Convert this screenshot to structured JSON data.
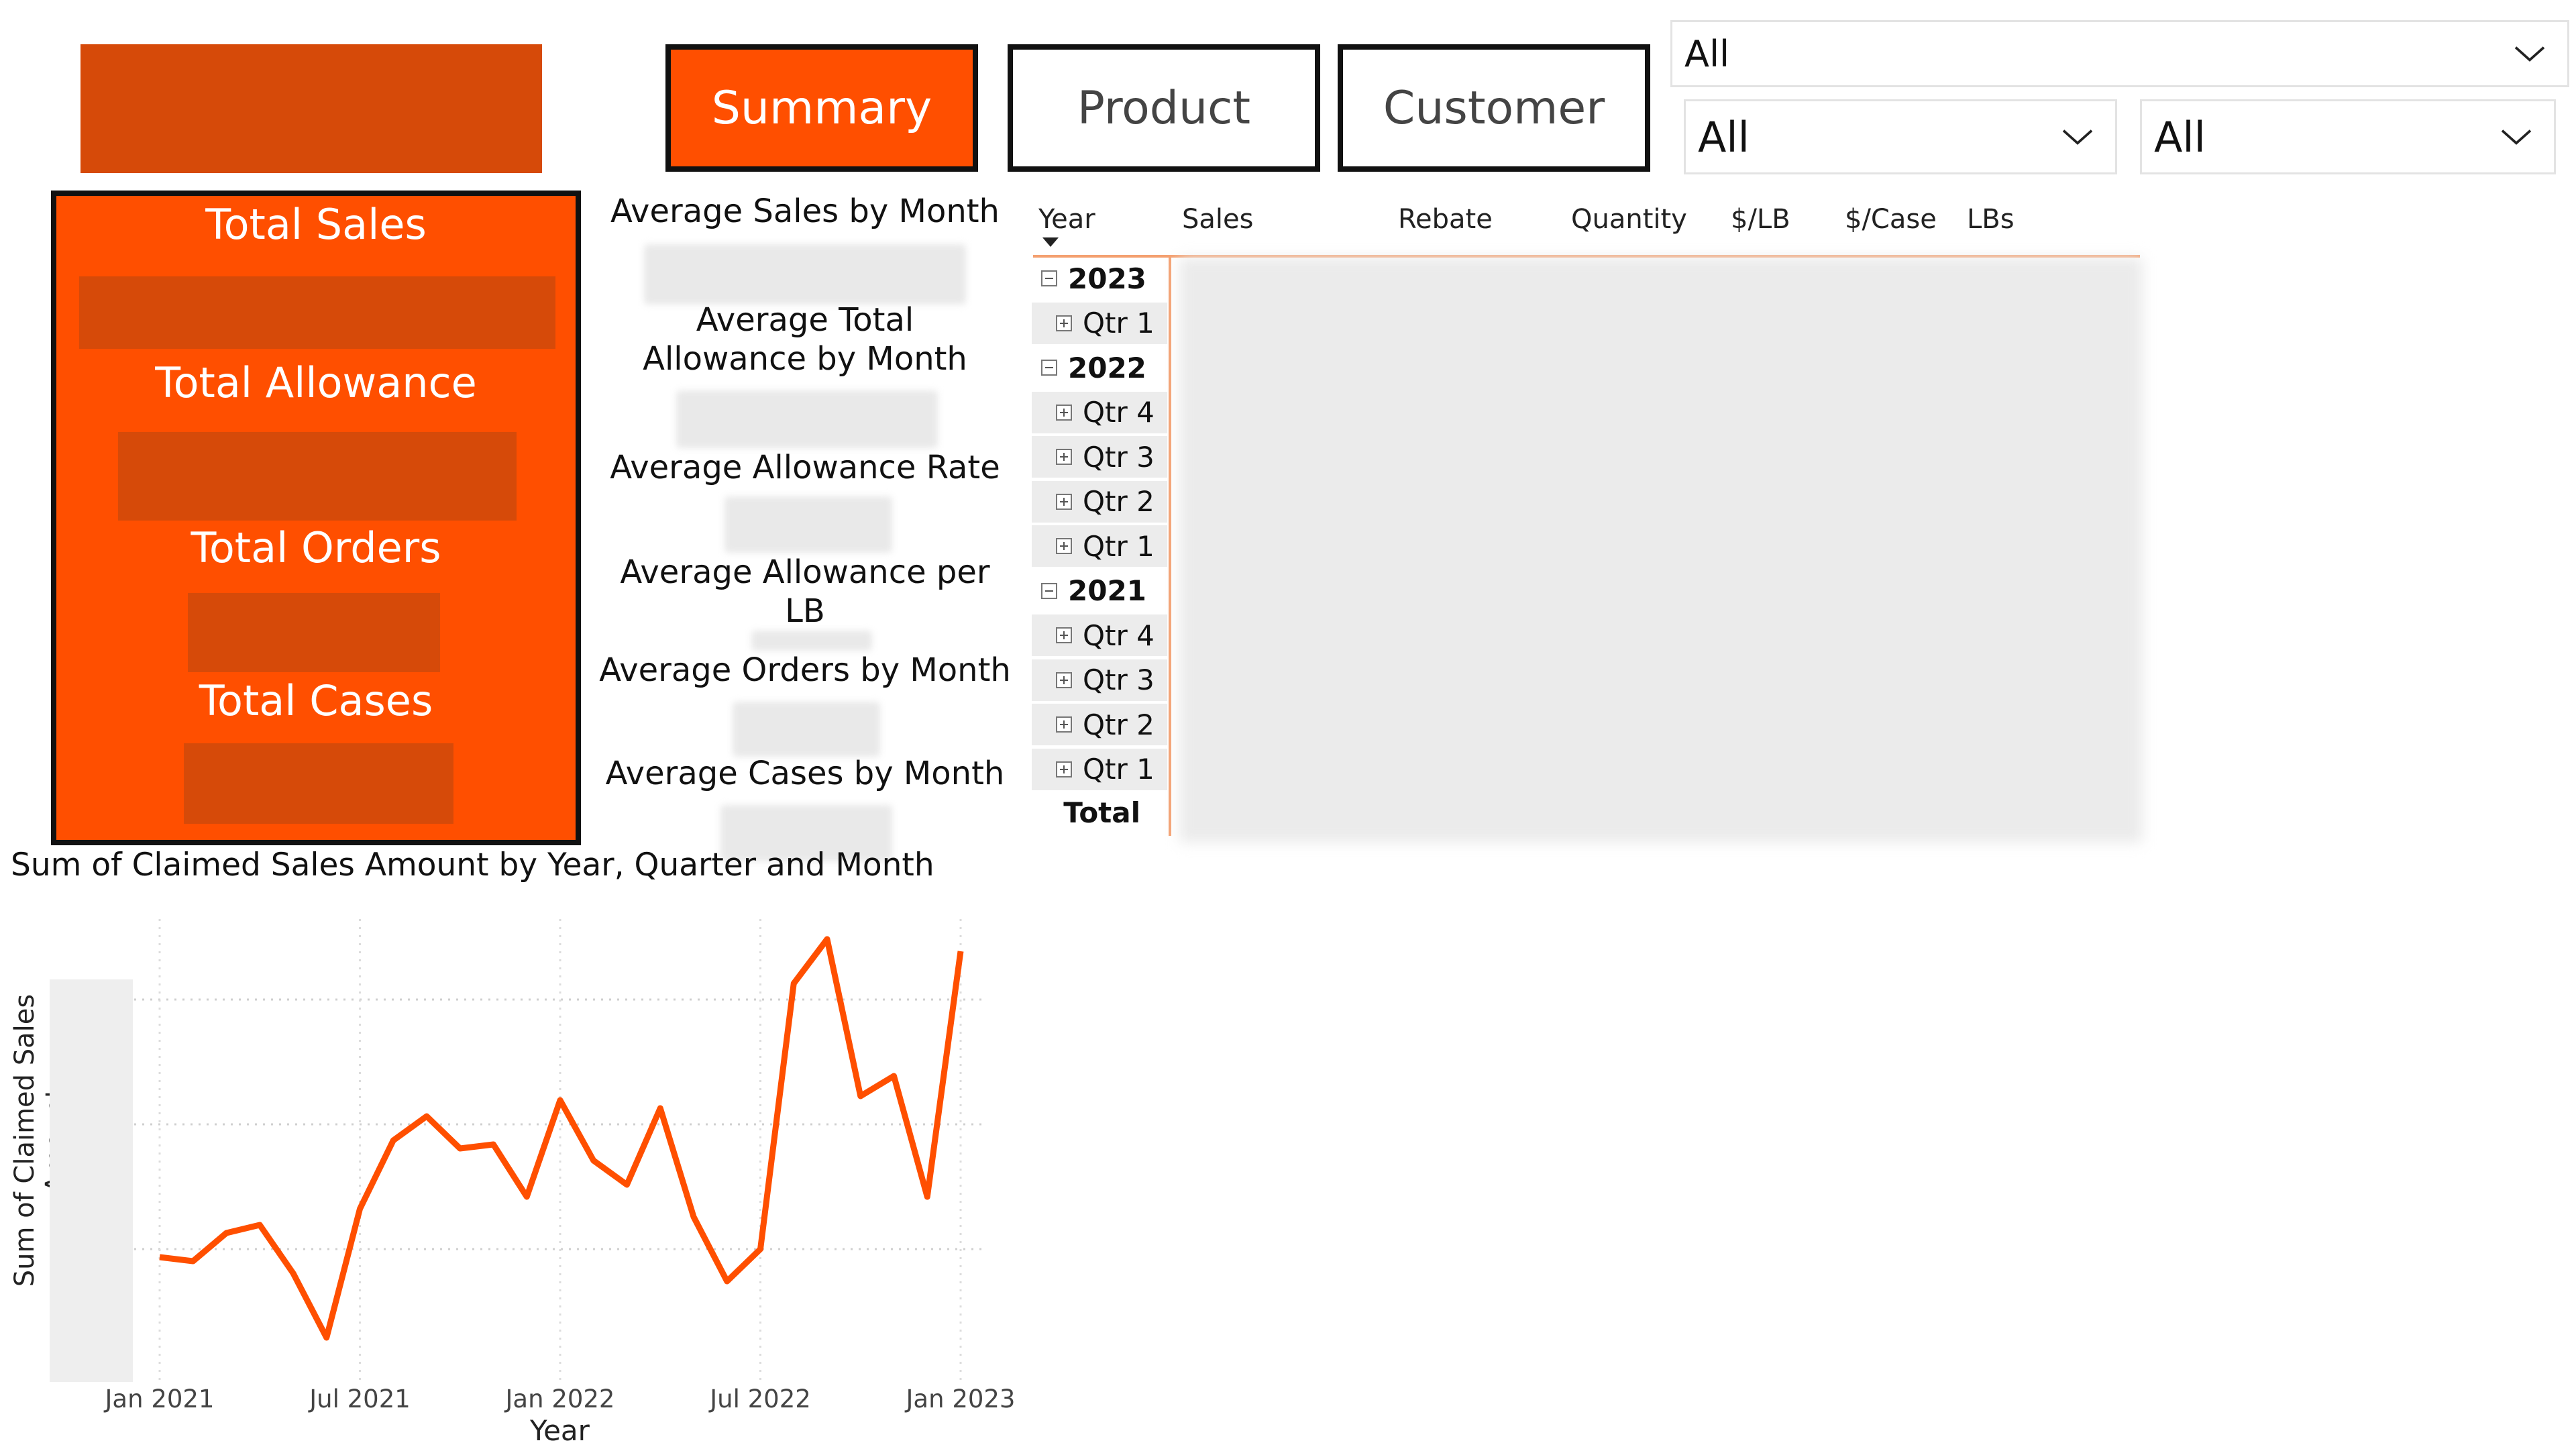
{
  "nav": {
    "summary_label": "Summary",
    "product_label": "Product",
    "customer_label": "Customer"
  },
  "slicers": {
    "top_value": "All",
    "left_value": "All",
    "right_value": "All"
  },
  "kpis": {
    "total_sales_label": "Total Sales",
    "total_allowance_label": "Total Allowance",
    "total_orders_label": "Total Orders",
    "total_cases_label": "Total Cases"
  },
  "averages": {
    "avg_sales_label": "Average Sales by Month",
    "avg_total_allowance_label": "Average Total Allowance by Month",
    "avg_allowance_rate_label": "Average Allowance Rate",
    "avg_allowance_per_lb_label": "Average Allowance per LB",
    "avg_orders_label": "Average Orders by Month",
    "avg_cases_label": "Average Cases by Month"
  },
  "matrix": {
    "headers": [
      "Year",
      "Sales",
      "Rebate",
      "Quantity",
      "$/LB",
      "$/Case",
      "LBs"
    ],
    "rows": [
      {
        "label": "2023",
        "type": "year",
        "toggle": "minus"
      },
      {
        "label": "Qtr 1",
        "type": "qtr",
        "toggle": "plus"
      },
      {
        "label": "2022",
        "type": "year",
        "toggle": "minus"
      },
      {
        "label": "Qtr 4",
        "type": "qtr",
        "toggle": "plus"
      },
      {
        "label": "Qtr 3",
        "type": "qtr",
        "toggle": "plus"
      },
      {
        "label": "Qtr 2",
        "type": "qtr",
        "toggle": "plus"
      },
      {
        "label": "Qtr 1",
        "type": "qtr",
        "toggle": "plus"
      },
      {
        "label": "2021",
        "type": "year",
        "toggle": "minus"
      },
      {
        "label": "Qtr 4",
        "type": "qtr",
        "toggle": "plus"
      },
      {
        "label": "Qtr 3",
        "type": "qtr",
        "toggle": "plus"
      },
      {
        "label": "Qtr 2",
        "type": "qtr",
        "toggle": "plus"
      },
      {
        "label": "Qtr 1",
        "type": "qtr",
        "toggle": "plus"
      }
    ],
    "total_label": "Total"
  },
  "chart_data": {
    "type": "line",
    "title": "Sum of Claimed Sales Amount by Year, Quarter and Month",
    "xlabel": "Year",
    "ylabel": "Sum of Claimed Sales Amount",
    "x_ticks": [
      "Jan 2021",
      "Jul 2021",
      "Jan 2022",
      "Jul 2022",
      "Jan 2023"
    ],
    "x": [
      "Jan 2021",
      "Feb 2021",
      "Mar 2021",
      "Apr 2021",
      "May 2021",
      "Jun 2021",
      "Jul 2021",
      "Aug 2021",
      "Sep 2021",
      "Oct 2021",
      "Nov 2021",
      "Dec 2021",
      "Jan 2022",
      "Feb 2022",
      "Mar 2022",
      "Apr 2022",
      "May 2022",
      "Jun 2022",
      "Jul 2022",
      "Aug 2022",
      "Sep 2022",
      "Oct 2022",
      "Nov 2022",
      "Dec 2022",
      "Jan 2023"
    ],
    "series": [
      {
        "values": [
          0.31,
          0.3,
          0.37,
          0.39,
          0.27,
          0.11,
          0.43,
          0.6,
          0.66,
          0.58,
          0.59,
          0.46,
          0.7,
          0.55,
          0.49,
          0.68,
          0.41,
          0.25,
          0.33,
          0.99,
          1.1,
          0.71,
          0.76,
          0.46,
          1.07
        ]
      }
    ],
    "y_values_note": "",
    "grid": true,
    "color": "#ff4f00"
  },
  "colors": {
    "accent": "#ff4f00",
    "accent_dark": "#d64a09"
  }
}
